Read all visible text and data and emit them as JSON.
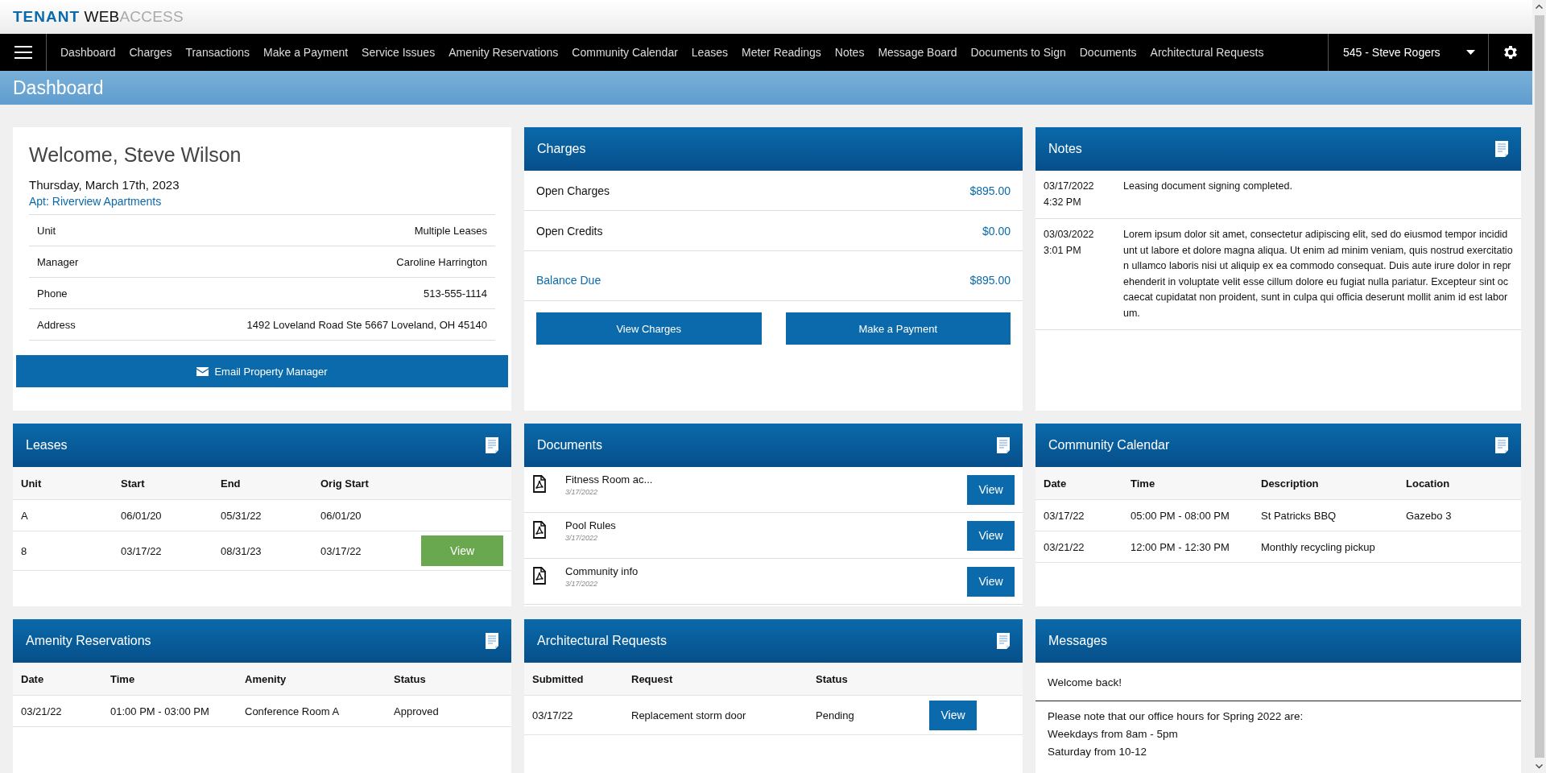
{
  "brand": {
    "bold": "TENANT",
    "mid": "WEB",
    "light": "ACCESS"
  },
  "nav": {
    "items": [
      "Dashboard",
      "Charges",
      "Transactions",
      "Make a Payment",
      "Service Issues",
      "Amenity Reservations",
      "Community Calendar",
      "Leases",
      "Meter Readings",
      "Notes",
      "Message Board",
      "Documents to Sign",
      "Documents",
      "Architectural Requests"
    ],
    "account": "545 - Steve Rogers"
  },
  "page_title": "Dashboard",
  "welcome": {
    "greeting": "Welcome, Steve Wilson",
    "date": "Thursday, March 17th, 2023",
    "apartment": "Apt: Riverview Apartments",
    "details": [
      {
        "label": "Unit",
        "value": "Multiple Leases"
      },
      {
        "label": "Manager",
        "value": "Caroline Harrington"
      },
      {
        "label": "Phone",
        "value": "513-555-1114"
      },
      {
        "label": "Address",
        "value": "1492 Loveland Road Ste 5667 Loveland, OH 45140"
      }
    ],
    "button": "Email Property Manager"
  },
  "charges": {
    "title": "Charges",
    "header_icon": false,
    "rows": [
      {
        "label": "Open Charges",
        "amount": "$895.00",
        "highlight": false
      },
      {
        "label": "Open Credits",
        "amount": "$0.00",
        "highlight": false
      },
      {
        "label": "Balance Due",
        "amount": "$895.00",
        "highlight": true
      }
    ],
    "buttons": [
      "View Charges",
      "Make a Payment"
    ]
  },
  "notes": {
    "title": "Notes",
    "header_icon": true,
    "items": [
      {
        "date": "03/17/2022",
        "time": "4:32 PM",
        "text": "Leasing document signing completed."
      },
      {
        "date": "03/03/2022",
        "time": "3:01 PM",
        "text": "Lorem ipsum dolor sit amet, consectetur adipiscing elit, sed do eiusmod tempor incididunt ut labore et dolore magna aliqua. Ut enim ad minim veniam, quis nostrud exercitation ullamco laboris nisi ut aliquip ex ea commodo consequat. Duis aute irure dolor in reprehenderit in voluptate velit esse cillum dolore eu fugiat nulla pariatur. Excepteur sint occaecat cupidatat non proident, sunt in culpa qui officia deserunt mollit anim id est laborum."
      }
    ]
  },
  "leases": {
    "title": "Leases",
    "header_icon": true,
    "columns": [
      "Unit",
      "Start",
      "End",
      "Orig Start"
    ],
    "rows": [
      {
        "cells": [
          "A",
          "06/01/20",
          "05/31/22",
          "06/01/20"
        ]
      },
      {
        "cells": [
          "8",
          "03/17/22",
          "08/31/23",
          "03/17/22"
        ],
        "action": "View"
      }
    ]
  },
  "documents": {
    "title": "Documents",
    "header_icon": true,
    "items": [
      {
        "name": "Fitness Room ac...",
        "date": "3/17/2022",
        "action": "View"
      },
      {
        "name": "Pool Rules",
        "date": "3/17/2022",
        "action": "View"
      },
      {
        "name": "Community info",
        "date": "3/17/2022",
        "action": "View"
      }
    ]
  },
  "community_calendar": {
    "title": "Community Calendar",
    "header_icon": true,
    "columns": [
      "Date",
      "Time",
      "Description",
      "Location"
    ],
    "rows": [
      {
        "cells": [
          "03/17/22",
          "05:00 PM - 08:00 PM",
          "St Patricks BBQ",
          "Gazebo 3"
        ]
      },
      {
        "cells": [
          "03/21/22",
          "12:00 PM - 12:30 PM",
          "Monthly recycling pickup"
        ]
      }
    ]
  },
  "amenity_reservations": {
    "title": "Amenity Reservations",
    "header_icon": true,
    "columns": [
      "Date",
      "Time",
      "Amenity",
      "Status"
    ],
    "rows": [
      {
        "cells": [
          "03/21/22",
          "01:00 PM - 03:00 PM",
          "Conference Room A",
          "Approved"
        ]
      }
    ]
  },
  "architectural_requests": {
    "title": "Architectural Requests",
    "header_icon": true,
    "columns": [
      "Submitted",
      "Request",
      "Status"
    ],
    "rows": [
      {
        "cells": [
          "03/17/22",
          "Replacement storm door",
          "Pending"
        ],
        "action": "View"
      }
    ]
  },
  "messages": {
    "title": "Messages",
    "header_icon": false,
    "blocks": [
      [
        "Welcome back!"
      ],
      [
        "Please note that our office hours for Spring 2022 are:",
        "Weekdays from 8am - 5pm",
        "Saturday from 10-12"
      ]
    ]
  }
}
